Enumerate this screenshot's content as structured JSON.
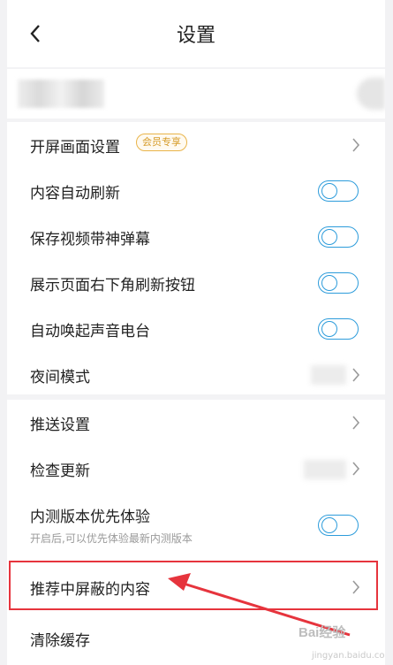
{
  "header": {
    "title": "设置"
  },
  "group1": [
    {
      "label": "开屏画面设置",
      "badge": "会员专享",
      "control": "chevron"
    },
    {
      "label": "内容自动刷新",
      "control": "toggle",
      "on": false
    },
    {
      "label": "保存视频带神弹幕",
      "control": "toggle",
      "on": false
    },
    {
      "label": "展示页面右下角刷新按钮",
      "control": "toggle",
      "on": false
    },
    {
      "label": "自动唤起声音电台",
      "control": "toggle",
      "on": false
    },
    {
      "label": "夜间模式",
      "control": "chevron"
    }
  ],
  "group2": [
    {
      "label": "推送设置",
      "control": "chevron"
    },
    {
      "label": "检查更新",
      "control": "chevron"
    },
    {
      "label": "内测版本优先体验",
      "sublabel": "开启后,可以优先体验最新内测版本",
      "control": "toggle",
      "on": false
    },
    {
      "label": "推荐中屏蔽的内容",
      "control": "chevron",
      "highlighted": true
    },
    {
      "label": "清除缓存"
    }
  ],
  "watermark": {
    "brand": "Bai经验",
    "url": "jingyan.baidu.com"
  },
  "colors": {
    "toggle": "#2d9cdb",
    "highlight": "#e6343d",
    "badge": "#d59a26"
  }
}
